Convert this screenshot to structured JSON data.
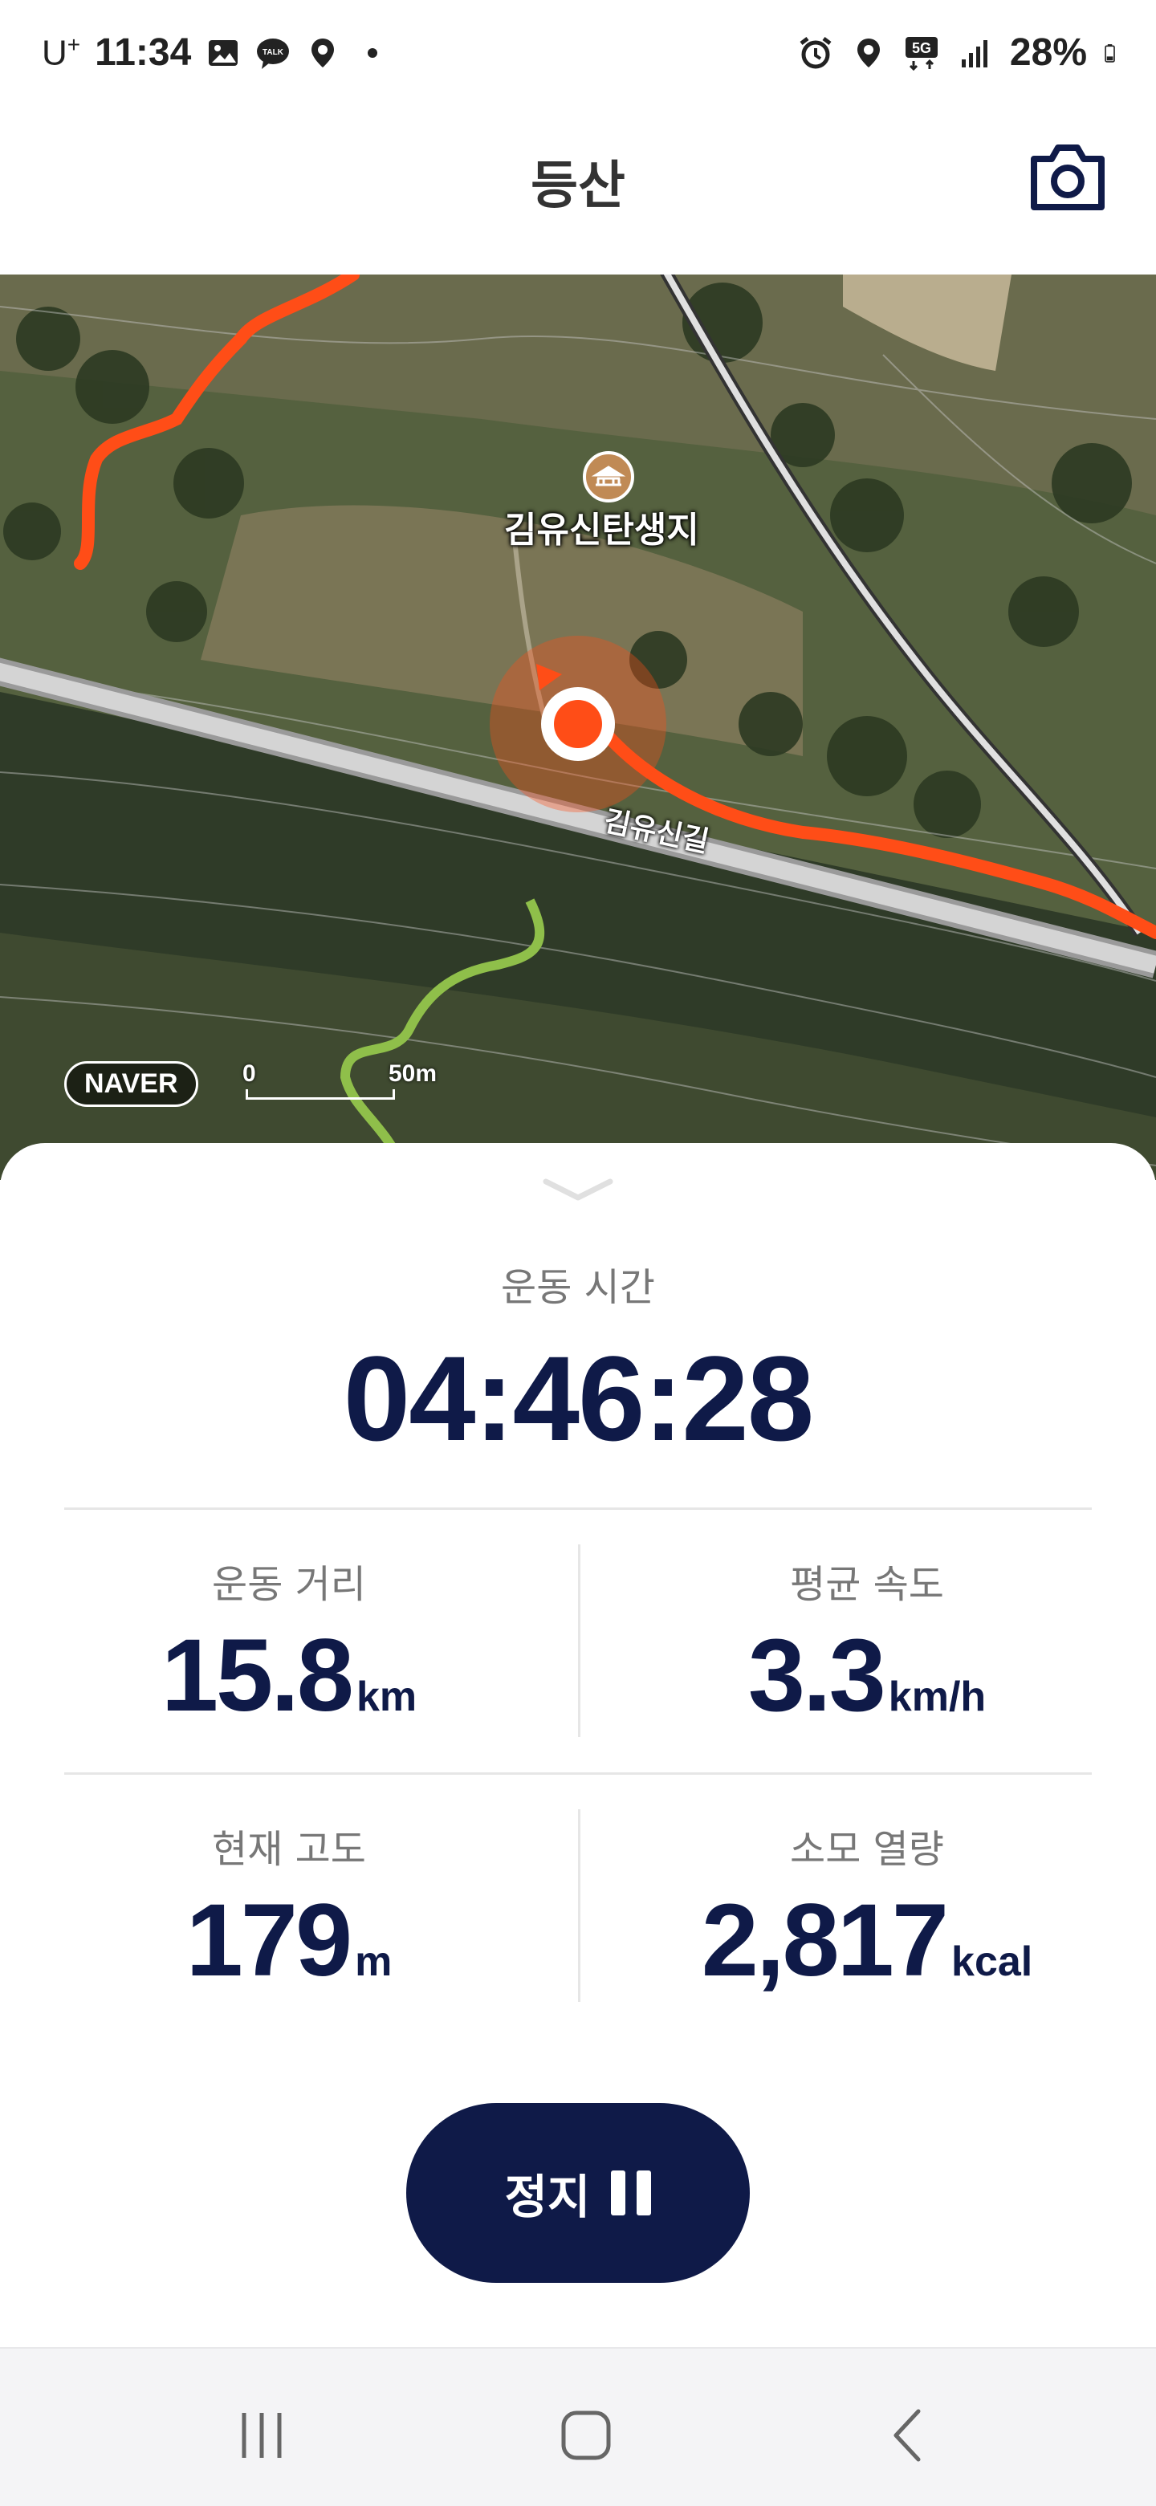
{
  "status_bar": {
    "carrier": "U",
    "carrier_sup": "+",
    "time": "11:34",
    "battery": "28%",
    "left_icons": [
      "gallery-icon",
      "talk-icon",
      "location-icon",
      "dot-icon"
    ],
    "right_icons": [
      "alarm-icon",
      "location-icon",
      "5g-icon",
      "signal-icon",
      "battery-icon"
    ]
  },
  "header": {
    "title": "등산",
    "camera_icon": "camera-icon"
  },
  "map": {
    "place_label": "김유신탄생지",
    "road_label": "김유신길",
    "provider": "NAVER",
    "scale_min": "0",
    "scale_max": "50m",
    "colors": {
      "track": "#ff4d17",
      "trail": "#8fbf4a",
      "road": "#c8c8c8"
    }
  },
  "workout": {
    "time_label": "운동 시간",
    "time_value": "04:46:28",
    "stats": {
      "distance": {
        "label": "운동 거리",
        "value": "15.8",
        "unit": "km"
      },
      "speed": {
        "label": "평균 속도",
        "value": "3.3",
        "unit": "km/h"
      },
      "altitude": {
        "label": "현재 고도",
        "value": "179",
        "unit": "m"
      },
      "calories": {
        "label": "소모 열량",
        "value": "2,817",
        "unit": "kcal"
      }
    },
    "stop_label": "정지"
  },
  "colors": {
    "accent_navy": "#0f1a48",
    "track_orange": "#ff4d17"
  }
}
